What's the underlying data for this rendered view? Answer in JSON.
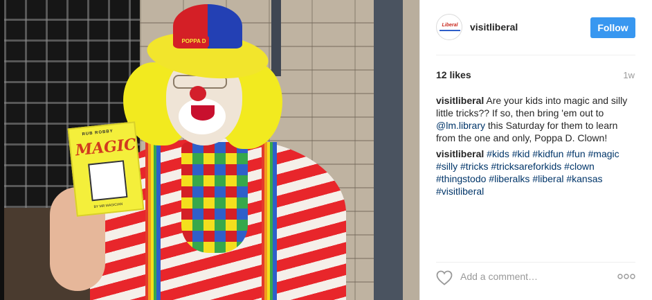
{
  "post": {
    "image": {
      "book_cover_small": "RUB ROBBY",
      "book_title": "MAGIC",
      "book_footer": "BY MR MAGICIAN",
      "hat_band_text": "POPPA D"
    },
    "author": {
      "avatar_logo_text": "Liberal",
      "username": "visitliberal"
    },
    "follow_label": "Follow",
    "likes": "12 likes",
    "time_ago": "1w",
    "caption": {
      "username": "visitliberal",
      "text_before_link": " Are your kids into magic and silly little tricks?? If so, then bring 'em out to ",
      "mention": "@lm.library",
      "text_after_link": " this Saturday for them to learn from the one and only, Poppa D. Clown!"
    },
    "comment_1": {
      "username": "visitliberal",
      "hashtags": [
        "#kids",
        "#kid",
        "#kidfun",
        "#fun",
        "#magic",
        "#silly",
        "#tricks",
        "#tricksareforkids",
        "#clown",
        "#thingstodo",
        "#liberalks",
        "#liberal",
        "#kansas",
        "#visitliberal"
      ]
    },
    "comment_box": {
      "placeholder": "Add a comment…"
    },
    "icons": {
      "like": "heart-icon",
      "options": "more-options-icon"
    },
    "colors": {
      "follow_button": "#3897f0",
      "link": "#003569",
      "muted": "#999999"
    }
  }
}
